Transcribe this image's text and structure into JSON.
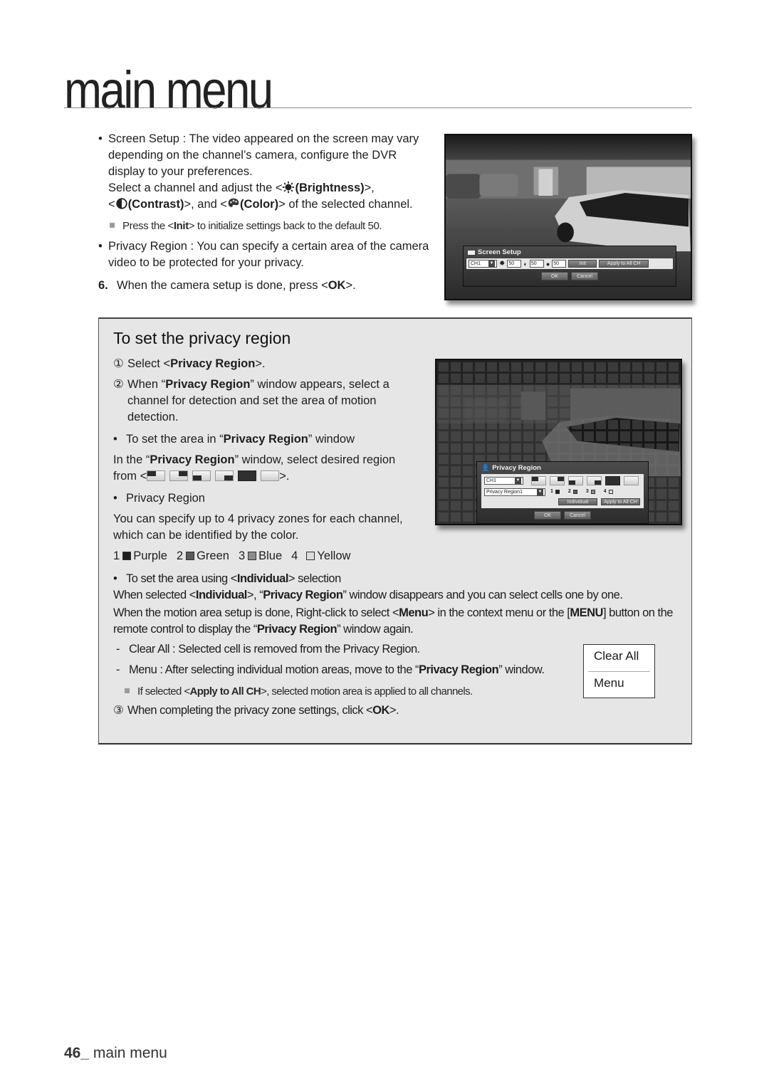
{
  "header": {
    "title": "main menu"
  },
  "screen_setup": {
    "bullet_lead": "Screen Setup : The video appeared on the screen may vary depending on the channel’s camera, configure the DVR display to your preferences.",
    "line_select_prefix": "Select a channel and adjust the <",
    "brightness_label": "(Brightness)",
    "line_sep1": ">,",
    "lt": "<",
    "contrast_label": "(Contrast)",
    "and_text": ">, and <",
    "color_label": "(Color)",
    "line_suffix": "> of the selected channel.",
    "note_prefix": "Press the <",
    "note_init": "Init",
    "note_suffix": "> to initialize settings back to the default 50.",
    "privacy_bullet": "Privacy Region : You can specify a certain area of the camera video to be protected for your privacy.",
    "step6_num": "6.",
    "step6_prefix": "When the camera setup is done, press <",
    "step6_ok": "OK",
    "step6_suffix": ">."
  },
  "screen_setup_osd": {
    "title": "Screen Setup",
    "channel": "CH1",
    "brightness": "50",
    "contrast": "50",
    "color": "50",
    "init_label": "Init",
    "apply_all_label": "Apply to All CH",
    "ok_label": "OK",
    "cancel_label": "Cancel"
  },
  "privacy_box": {
    "title": "To set the privacy region",
    "step1_num": "①",
    "step1_prefix": "Select <",
    "step1_bold": "Privacy Region",
    "step1_suffix": ">.",
    "step2_num": "②",
    "step2_prefix": "When “",
    "step2_bold": "Privacy Region",
    "step2_suffix": "” window appears, select a channel for detection and set the area of motion detection.",
    "sub1_prefix": "To set the area in “",
    "sub1_bold": "Privacy Region",
    "sub1_suffix": "” window",
    "in_prefix": "In the “",
    "in_bold": "Privacy Region",
    "in_suffix": "” window, select desired region",
    "from_prefix": "from <",
    "from_suffix": ">.",
    "region_bullet": "Privacy Region",
    "zones_text": "You can specify up to 4 privacy zones for each channel, which can be identified by the color.",
    "zones": [
      {
        "num": "1",
        "name": "Purple",
        "swatch": "#1e1e1e"
      },
      {
        "num": "2",
        "name": "Green",
        "swatch": "#5a5a5a"
      },
      {
        "num": "3",
        "name": "Blue",
        "swatch": "#8c8c8c"
      },
      {
        "num": "4",
        "name": "Yellow",
        "swatch": "#dcdcdc"
      }
    ],
    "individual_bullet_prefix": "To set the area using <",
    "individual_bold": "Individual",
    "individual_bullet_suffix": "> selection",
    "when_selected_prefix": "When selected <",
    "when_selected_bold": "Individual",
    "when_selected_mid": ">, “",
    "when_selected_bold2": "Privacy Region",
    "when_selected_suffix": "” window disappears and you can select cells one by one.",
    "motion_prefix": "When the motion area setup is done, Right-click to select <",
    "motion_menu": "Menu",
    "motion_mid": "> in the context menu or the [",
    "motion_menu_btn": "MENU",
    "motion_mid2": "] button on the remote control to display the “",
    "motion_bold": "Privacy Region",
    "motion_suffix": "” window again.",
    "clear_all_desc": "Clear All : Selected cell is removed from the Privacy Region.",
    "menu_desc_prefix": "Menu : After selecting individual motion areas, move to the “",
    "menu_desc_bold": "Privacy Region",
    "menu_desc_suffix": "” window.",
    "note_prefix": "If selected <",
    "note_bold": "Apply to All CH",
    "note_suffix": ">, selected motion area is applied to all channels.",
    "step3_num": "③",
    "step3_prefix": "When completing the privacy zone settings, click <",
    "step3_ok": "OK",
    "step3_suffix": ">."
  },
  "context_menu": {
    "items": [
      "Clear All",
      "Menu"
    ]
  },
  "privacy_osd": {
    "title": "Privacy Region",
    "channel": "CH1",
    "region": "Privacy Region1",
    "zone_numbers": [
      "1",
      "2",
      "3",
      "4"
    ],
    "individual_label": "Individual",
    "apply_all_label": "Apply to All CH",
    "ok_label": "OK",
    "cancel_label": "Cancel"
  },
  "footer": {
    "page_number": "46_",
    "section": "main menu"
  }
}
